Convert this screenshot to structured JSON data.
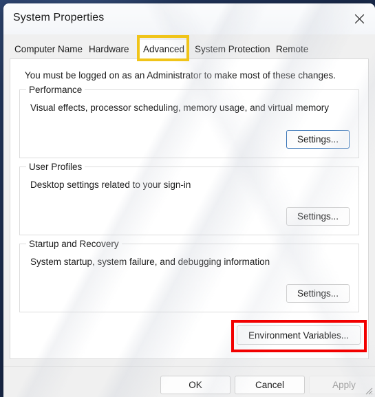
{
  "window": {
    "title": "System Properties",
    "close_icon": "close-icon"
  },
  "tabs": [
    {
      "label": "Computer Name",
      "selected": false
    },
    {
      "label": "Hardware",
      "selected": false
    },
    {
      "label": "Advanced",
      "selected": true
    },
    {
      "label": "System Protection",
      "selected": false
    },
    {
      "label": "Remote",
      "selected": false
    }
  ],
  "panel": {
    "admin_note": "You must be logged on as an Administrator to make most of these changes.",
    "groups": [
      {
        "title": "Performance",
        "description": "Visual effects, processor scheduling, memory usage, and virtual memory",
        "button_label": "Settings...",
        "button_focused": true
      },
      {
        "title": "User Profiles",
        "description": "Desktop settings related to your sign-in",
        "button_label": "Settings...",
        "button_focused": false
      },
      {
        "title": "Startup and Recovery",
        "description": "System startup, system failure, and debugging information",
        "button_label": "Settings...",
        "button_focused": false
      }
    ],
    "environment_variables_label": "Environment Variables..."
  },
  "footer": {
    "ok_label": "OK",
    "cancel_label": "Cancel",
    "apply_label": "Apply",
    "apply_disabled": true
  },
  "annotations": {
    "tab_highlight_color": "#f0c419",
    "button_highlight_color": "#f20000"
  }
}
